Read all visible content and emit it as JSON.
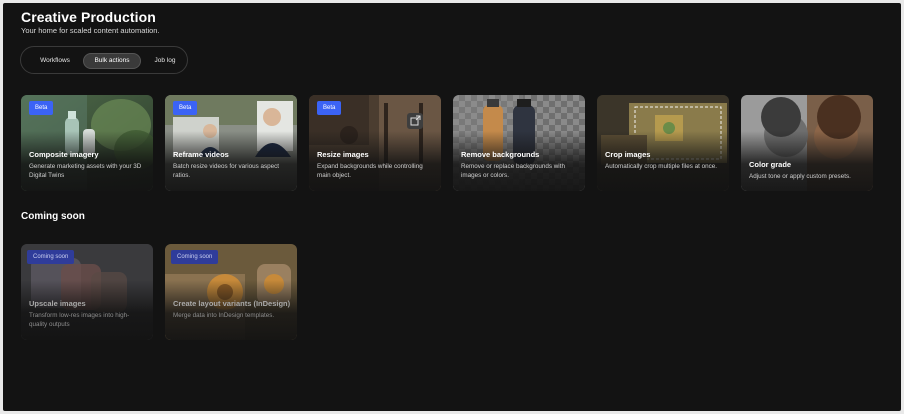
{
  "header": {
    "title": "Creative Production",
    "subtitle": "Your home for scaled content automation."
  },
  "tabs": [
    {
      "label": "Workflows"
    },
    {
      "label": "Bulk actions",
      "selected": true
    },
    {
      "label": "Job log"
    }
  ],
  "cards": [
    {
      "badge": "Beta",
      "title": "Composite imagery",
      "desc": "Generate marketing assets with your 3D Digital Twins"
    },
    {
      "badge": "Beta",
      "title": "Reframe videos",
      "desc": "Batch resize videos for various aspect ratios."
    },
    {
      "badge": "Beta",
      "title": "Resize images",
      "desc": "Expand backgrounds while controlling main object."
    },
    {
      "title": "Remove backgrounds",
      "desc": "Remove or replace backgrounds with images or colors."
    },
    {
      "title": "Crop images",
      "desc": "Automatically crop multiple files at once."
    },
    {
      "title": "Color grade",
      "desc": "Adjust tone or apply custom presets."
    }
  ],
  "coming_soon": {
    "heading": "Coming soon",
    "cards": [
      {
        "badge": "Coming soon",
        "title": "Upscale images",
        "desc": "Transform low-res images into high-quality outputs"
      },
      {
        "badge": "Coming soon",
        "title": "Create layout variants (InDesign)",
        "desc": "Merge data into InDesign templates."
      }
    ]
  },
  "colors": {
    "badge_beta": "#3b63f5",
    "badge_soon": "#2f3c9a",
    "background": "#131313"
  },
  "icons": [
    "image-expand-icon"
  ]
}
